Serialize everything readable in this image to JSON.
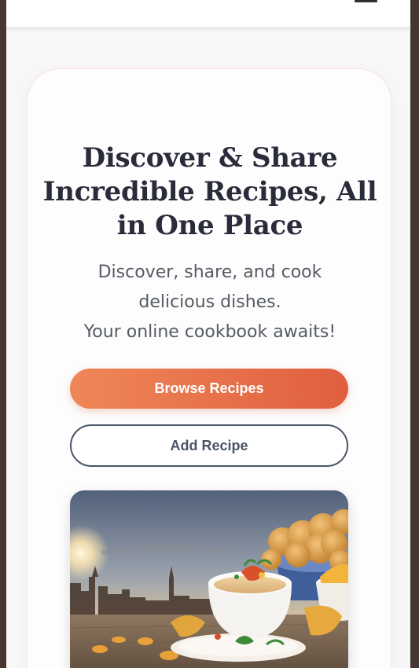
{
  "header": {
    "menu_icon": "hamburger-menu-icon"
  },
  "hero": {
    "title": "Discover & Share Incredible Recipes, All in One Place",
    "subtitle_line1": "Discover, share, and cook",
    "subtitle_line2": "delicious dishes.",
    "subtitle_line3": "Your online cookbook awaits!",
    "browse_button_label": "Browse Recipes",
    "add_button_label": "Add Recipe",
    "image_description_icon": "food-photo-soup-bowl"
  },
  "colors": {
    "accent_start": "#ef8758",
    "accent_end": "#e05f3e",
    "secondary": "#4b5568",
    "title": "#2a2b3b"
  }
}
